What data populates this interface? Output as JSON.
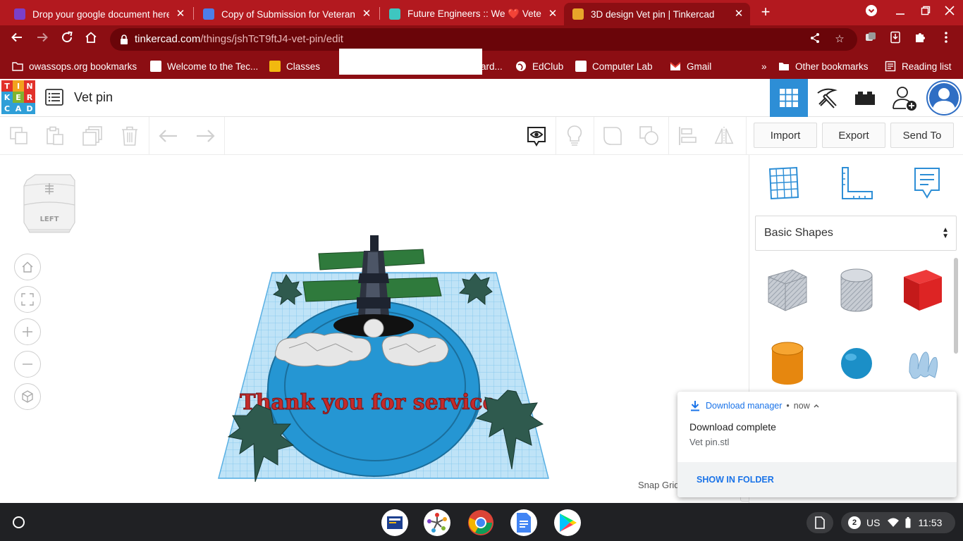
{
  "browser": {
    "tabs": [
      {
        "title": "Drop your google document here"
      },
      {
        "title": "Copy of Submission for Veteran's"
      },
      {
        "title": "Future Engineers :: We ❤️ Veteran"
      },
      {
        "title": "3D design Vet pin | Tinkercad"
      }
    ],
    "url_host": "tinkercad.com",
    "url_path": "/things/jshTcT9ftJ4-vet-pin/edit",
    "bookmarks": [
      "owassops.org bookmarks",
      "Welcome to the Tec...",
      "Classes",
      "ard...",
      "EdClub",
      "Computer Lab",
      "Gmail"
    ],
    "bookmarks_overflow": "»",
    "other_bookmarks": "Other bookmarks",
    "reading_list": "Reading list"
  },
  "tinkercad": {
    "logo_letters": [
      "T",
      "I",
      "N",
      "K",
      "E",
      "R",
      "C",
      "A",
      "D"
    ],
    "design_title": "Vet pin",
    "toolbar": {
      "import_label": "Import",
      "export_label": "Export",
      "send_to_label": "Send To"
    },
    "viewcube_face": "LEFT",
    "scene_text": "Thank you for service",
    "snap_label": "Snap Grid",
    "shape_category": "Basic Shapes"
  },
  "notification": {
    "app_name": "Download manager",
    "separator": "•",
    "time": "now",
    "title": "Download complete",
    "filename": "Vet pin.stl",
    "action": "SHOW IN FOLDER"
  },
  "shelf": {
    "notification_count": "2",
    "keyboard_layout": "US",
    "time": "11:53"
  },
  "colors": {
    "chrome_red": "#b3191f",
    "chrome_dark_red": "#8c0e13",
    "tinkercad_blue": "#2d8ed6",
    "link_blue": "#1a73e8"
  }
}
